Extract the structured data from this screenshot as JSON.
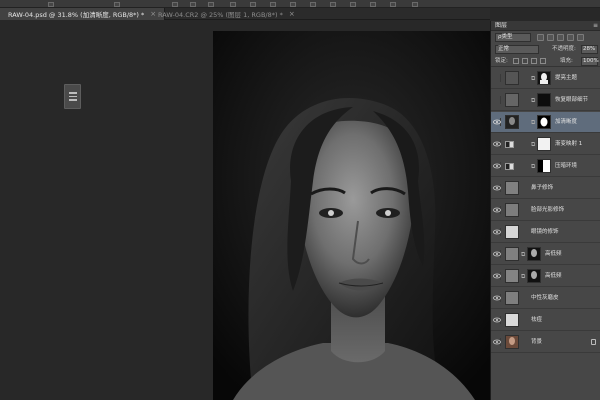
{
  "tabs": [
    {
      "label": "RAW-04.psd @ 31.8% (加清晰度, RGB/8*) *",
      "active": true
    },
    {
      "label": "RAW-04.CR2 @ 25% (图层 1, RGB/8*) *",
      "active": false
    }
  ],
  "panel": {
    "title": "图层",
    "filter_value": "ρ类型",
    "blend_mode": "正常",
    "opacity_label": "不透明度:",
    "opacity_value": "28%",
    "lock_label": "锁定:",
    "fill_label": "填充:",
    "fill_value": "100%"
  },
  "layers": [
    {
      "name": "提亮主题",
      "visible": false,
      "selected": false,
      "thumb": "white-mask-silhouette"
    },
    {
      "name": "恢复眼部细节",
      "visible": false,
      "selected": false,
      "thumb": "black-mask"
    },
    {
      "name": "加清晰度",
      "visible": true,
      "selected": true,
      "thumb": "portrait-with-mask"
    },
    {
      "name": "渐变映射 1",
      "visible": true,
      "selected": false,
      "thumb": "gradient-map"
    },
    {
      "name": "压暗环境",
      "visible": true,
      "selected": false,
      "thumb": "black-white-mask"
    },
    {
      "name": "鼻子修饰",
      "visible": true,
      "selected": false,
      "thumb": "gray"
    },
    {
      "name": "脸部光影修饰",
      "visible": true,
      "selected": false,
      "thumb": "gray"
    },
    {
      "name": "眼镜的修饰",
      "visible": true,
      "selected": false,
      "thumb": "light-gray"
    },
    {
      "name": "高低频",
      "visible": true,
      "selected": false,
      "thumb": "portrait-with-mask"
    },
    {
      "name": "高低频",
      "visible": true,
      "selected": false,
      "thumb": "portrait-with-mask"
    },
    {
      "name": "中性灰磨皮",
      "visible": true,
      "selected": false,
      "thumb": "gray"
    },
    {
      "name": "祛痘",
      "visible": true,
      "selected": false,
      "thumb": "light-gray"
    },
    {
      "name": "背景",
      "visible": true,
      "selected": false,
      "thumb": "portrait-color",
      "locked": true
    }
  ],
  "colors": {
    "workspace": "#282828",
    "panel": "#474747",
    "selected_layer": "#5f6c7c"
  }
}
